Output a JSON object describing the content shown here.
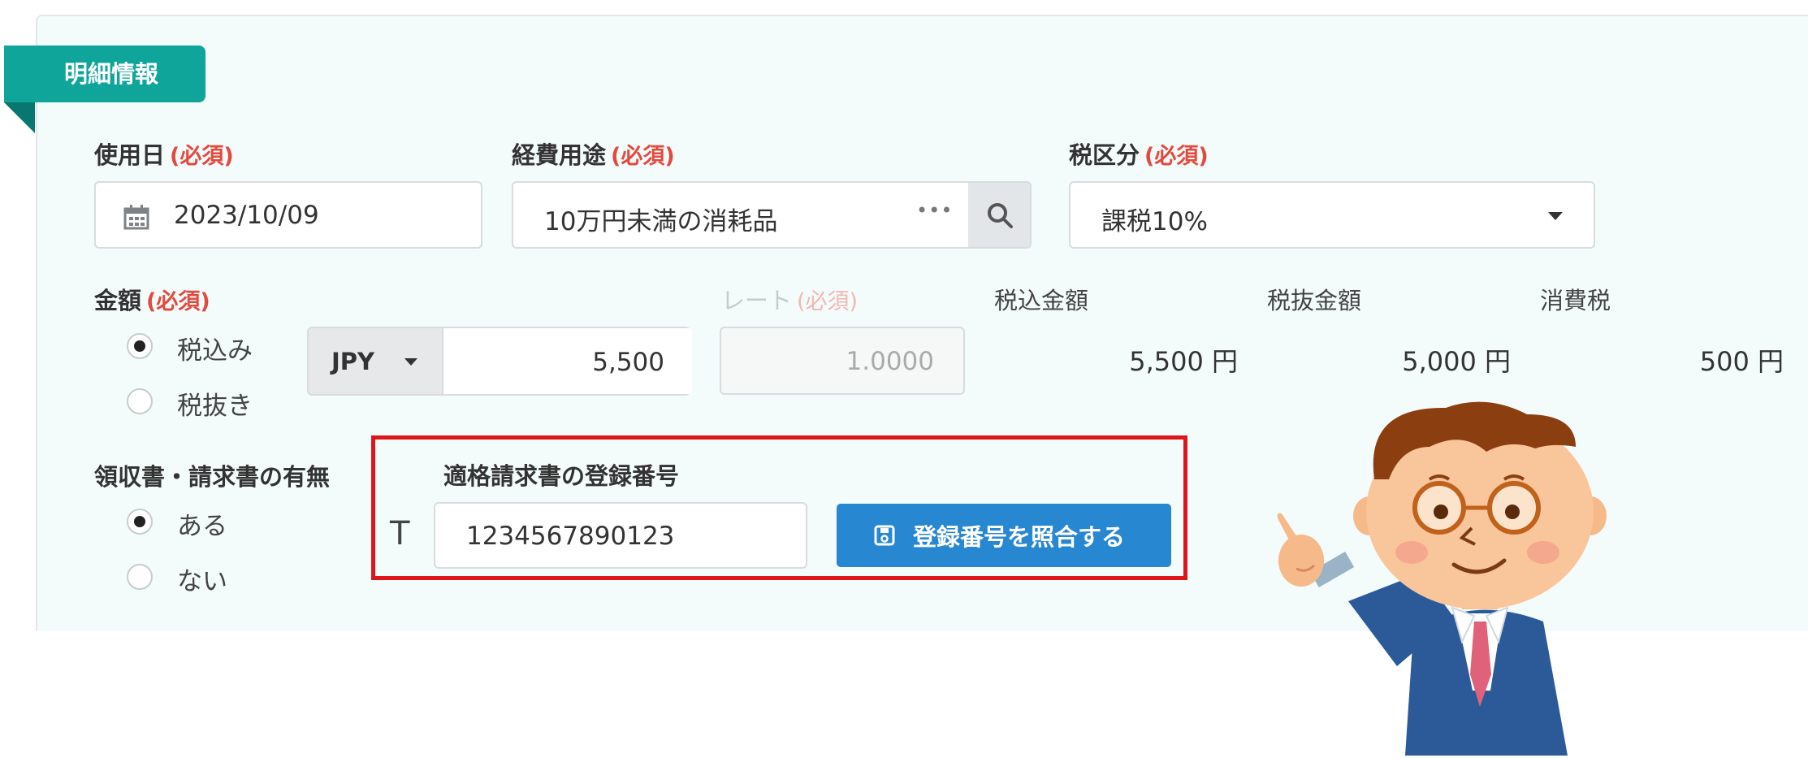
{
  "section": {
    "title": "明細情報"
  },
  "date": {
    "label": "使用日",
    "required": "(必須)",
    "value": "2023/10/09"
  },
  "expense": {
    "label": "経費用途",
    "required": "(必須)",
    "value": "10万円未満の消耗品",
    "more": "•••"
  },
  "tax_category": {
    "label": "税区分",
    "required": "(必須)",
    "value": "課税10%"
  },
  "amount": {
    "label": "金額",
    "required": "(必須)",
    "options": [
      "税込み",
      "税抜き"
    ],
    "selected": 0,
    "currency": "JPY",
    "value": "5,500"
  },
  "rate": {
    "label": "レート",
    "required": "(必須)",
    "value": "1.0000"
  },
  "totals": {
    "incl_label": "税込金額",
    "incl_value": "5,500 円",
    "excl_label": "税抜金額",
    "excl_value": "5,000 円",
    "tax_label": "消費税",
    "tax_value": "500 円"
  },
  "receipt": {
    "label": "領収書・請求書の有無",
    "options": [
      "ある",
      "ない"
    ],
    "selected": 0
  },
  "registration": {
    "label": "適格請求書の登録番号",
    "prefix": "T",
    "value": "1234567890123",
    "button": "登録番号を照合する"
  },
  "colors": {
    "accent": "#10a59b",
    "button": "#2787d1",
    "required": "#e34a3e",
    "highlight": "#e0141b"
  }
}
